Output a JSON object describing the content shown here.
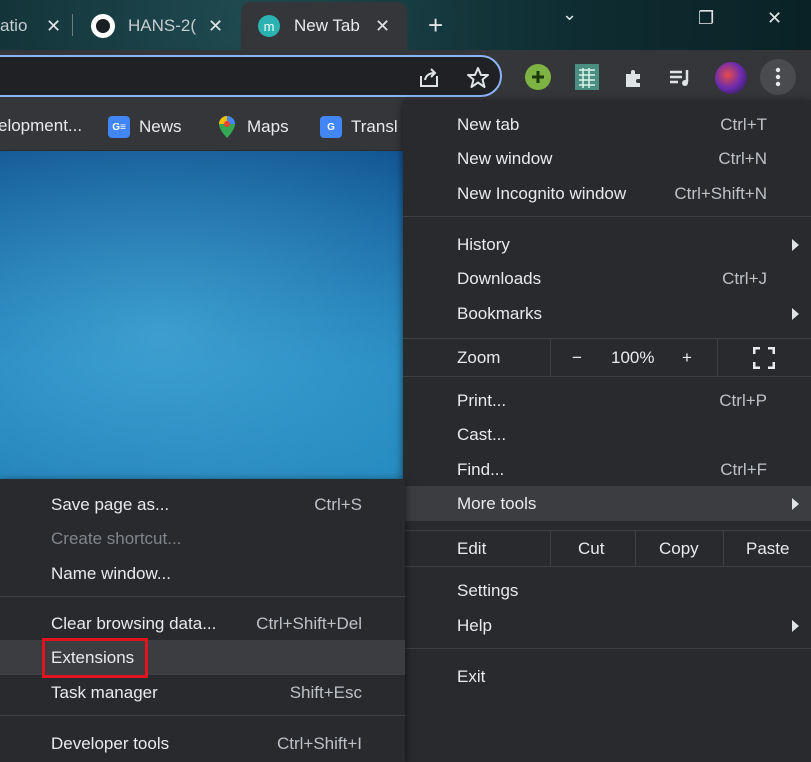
{
  "tabs": [
    {
      "title": "atio",
      "close": "✕"
    },
    {
      "title": "HANS-2(",
      "close": "✕"
    },
    {
      "title": "New Tab",
      "favicon": "m",
      "close": "✕"
    }
  ],
  "new_tab_glyph": "+",
  "window_controls": {
    "dropdown": "⌄",
    "restore": "❐",
    "close": "✕"
  },
  "bookmarks": [
    {
      "label": "elopment...",
      "icon": "dev-icon"
    },
    {
      "label": "News",
      "icon": "google-news-icon",
      "icon_text": "G≡"
    },
    {
      "label": "Maps",
      "icon": "google-maps-icon"
    },
    {
      "label": "Transl",
      "icon": "google-translate-icon",
      "icon_text": "G"
    }
  ],
  "main_menu": {
    "new_tab": {
      "label": "New tab",
      "shortcut": "Ctrl+T"
    },
    "new_window": {
      "label": "New window",
      "shortcut": "Ctrl+N"
    },
    "new_incognito": {
      "label": "New Incognito window",
      "shortcut": "Ctrl+Shift+N"
    },
    "history": {
      "label": "History"
    },
    "downloads": {
      "label": "Downloads",
      "shortcut": "Ctrl+J"
    },
    "bookmarks": {
      "label": "Bookmarks"
    },
    "zoom": {
      "label": "Zoom",
      "minus": "−",
      "level": "100%",
      "plus": "+"
    },
    "print": {
      "label": "Print...",
      "shortcut": "Ctrl+P"
    },
    "cast": {
      "label": "Cast..."
    },
    "find": {
      "label": "Find...",
      "shortcut": "Ctrl+F"
    },
    "more_tools": {
      "label": "More tools"
    },
    "edit": {
      "label": "Edit",
      "cut": "Cut",
      "copy": "Copy",
      "paste": "Paste"
    },
    "settings": {
      "label": "Settings"
    },
    "help": {
      "label": "Help"
    },
    "exit": {
      "label": "Exit"
    }
  },
  "more_tools_menu": {
    "save_page": {
      "label": "Save page as...",
      "shortcut": "Ctrl+S"
    },
    "create_shortcut": {
      "label": "Create shortcut...",
      "disabled": true
    },
    "name_window": {
      "label": "Name window..."
    },
    "clear_browsing": {
      "label": "Clear browsing data...",
      "shortcut": "Ctrl+Shift+Del"
    },
    "extensions": {
      "label": "Extensions"
    },
    "task_manager": {
      "label": "Task manager",
      "shortcut": "Shift+Esc"
    },
    "developer_tools": {
      "label": "Developer tools",
      "shortcut": "Ctrl+Shift+I"
    }
  },
  "colors": {
    "highlight_box": "#e0141e",
    "menu_bg": "#292a2d",
    "omnibox_focus": "#8ab4f8"
  }
}
